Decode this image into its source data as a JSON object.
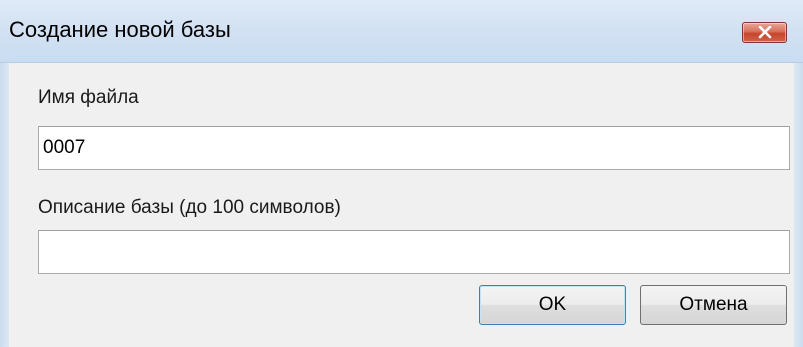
{
  "dialog": {
    "title": "Создание новой базы",
    "close_icon": "close-icon"
  },
  "form": {
    "filename_label": "Имя файла",
    "filename_value": "0007",
    "description_label": "Описание базы (до 100 символов)",
    "description_value": ""
  },
  "buttons": {
    "ok_label": "OK",
    "cancel_label": "Отмена"
  },
  "colors": {
    "close_button": "#c4452c",
    "default_button_border": "#3c7fb1"
  }
}
